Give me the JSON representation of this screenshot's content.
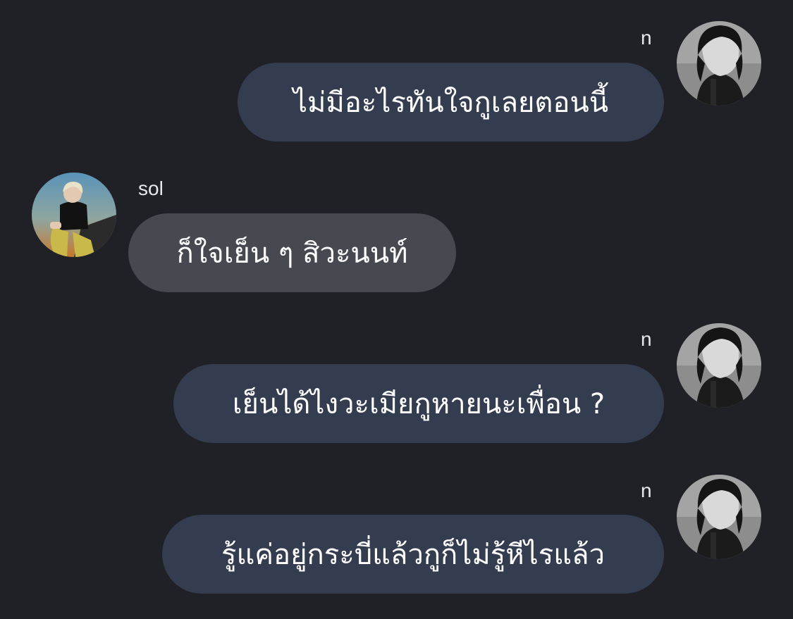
{
  "messages": [
    {
      "sender": "n",
      "text": "ไม่มีอะไรทันใจกูเลยตอนนี้",
      "side": "right"
    },
    {
      "sender": "sol",
      "text": "ก็ใจเย็น ๆ สิวะนนท์",
      "side": "left"
    },
    {
      "sender": "n",
      "text": "เย็นได้ไงวะเมียกูหายนะเพื่อน ?",
      "side": "right"
    },
    {
      "sender": "n",
      "text": "รู้แค่อยู่กระบี่แล้วกูก็ไม่รู้หีไรแล้ว",
      "side": "right"
    }
  ],
  "colors": {
    "background": "#1f2126",
    "bubble_mine": "#343d4f",
    "bubble_theirs": "#464950",
    "text": "#ffffff"
  }
}
